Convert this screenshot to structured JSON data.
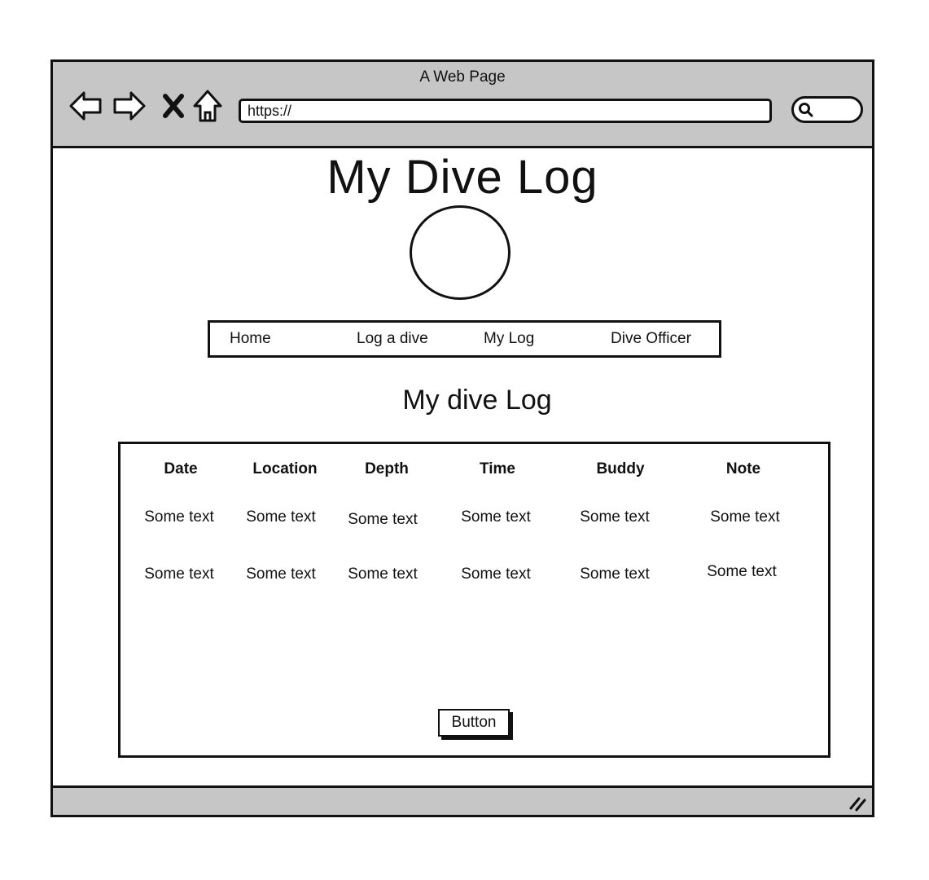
{
  "window": {
    "title": "A Web Page",
    "url": "https://"
  },
  "icons": {
    "back": "arrow-left-icon",
    "forward": "arrow-right-icon",
    "stop": "close-icon",
    "home": "home-icon",
    "search": "search-icon",
    "resize": "resize-grip-icon"
  },
  "page": {
    "title": "My Dive Log",
    "section_title": "My dive Log"
  },
  "nav": {
    "items": [
      {
        "label": "Home"
      },
      {
        "label": "Log a dive"
      },
      {
        "label": "My Log"
      },
      {
        "label": "Dive Officer"
      }
    ]
  },
  "table": {
    "headers": [
      "Date",
      "Location",
      "Depth",
      "Time",
      "Buddy",
      "Note"
    ],
    "rows": [
      [
        "Some text",
        "Some text",
        "Some text",
        "Some text",
        "Some text",
        "Some text"
      ],
      [
        "Some text",
        "Some text",
        "Some text",
        "Some text",
        "Some text",
        "Some text"
      ]
    ],
    "button_label": "Button"
  },
  "colors": {
    "chrome": "#c6c6c6",
    "stroke": "#111111",
    "background": "#ffffff"
  }
}
